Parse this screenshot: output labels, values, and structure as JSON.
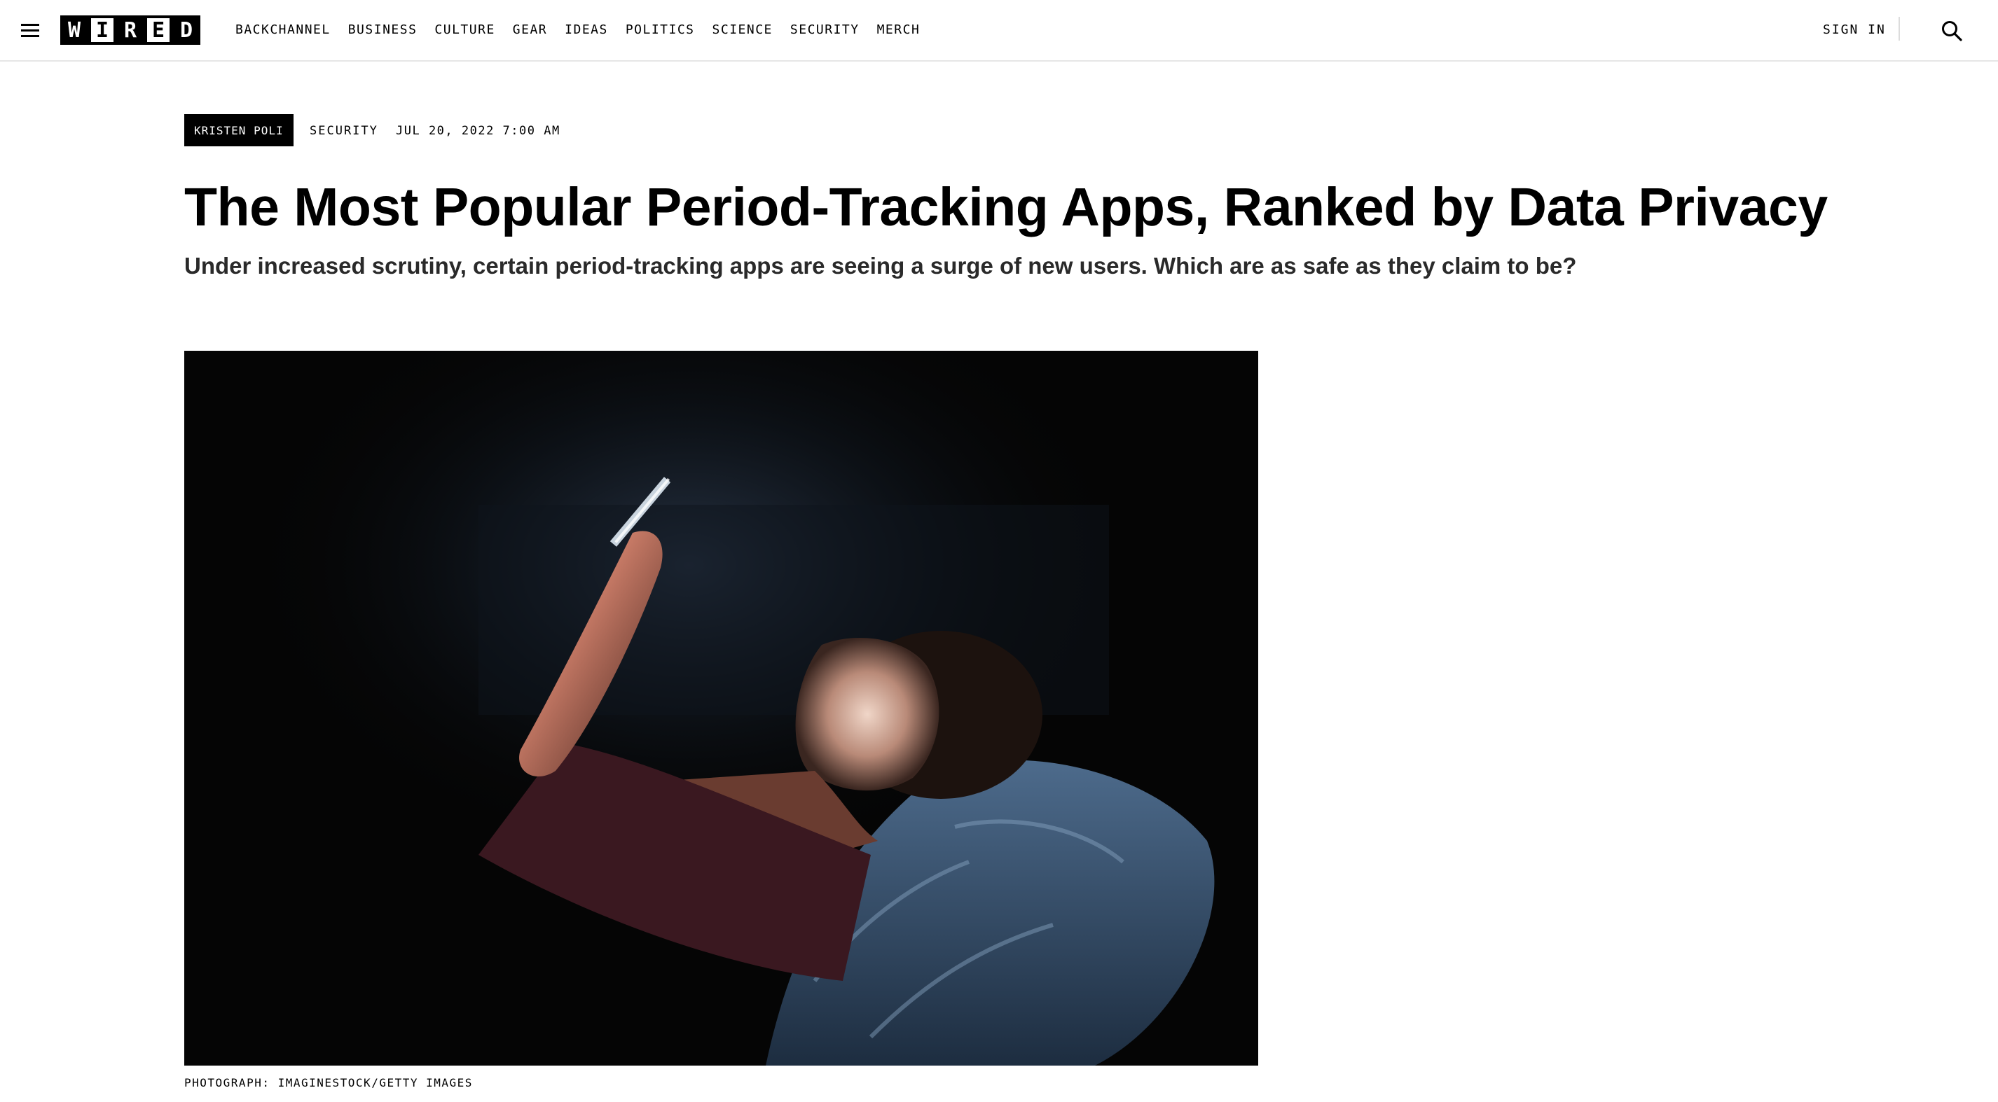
{
  "header": {
    "logo_text": "WIRED",
    "nav_items": [
      "BACKCHANNEL",
      "BUSINESS",
      "CULTURE",
      "GEAR",
      "IDEAS",
      "POLITICS",
      "SCIENCE",
      "SECURITY",
      "MERCH"
    ],
    "sign_in_label": "SIGN IN",
    "menu_icon": "hamburger-menu-icon",
    "search_icon": "search-icon"
  },
  "article": {
    "author": "KRISTEN POLI",
    "category": "SECURITY",
    "date": "JUL 20, 2022 7:00 AM",
    "title": "The Most Popular Period-Tracking Apps, Ranked by Data Privacy",
    "dek": "Under increased scrutiny, certain period-tracking apps are seeing a surge of new users. Which are as safe as they claim to be?",
    "image_caption": "PHOTOGRAPH: IMAGINESTOCK/GETTY IMAGES"
  },
  "colors": {
    "text": "#000000",
    "background": "#ffffff",
    "dek_text": "#2a2a2a",
    "divider": "#e6e6e6"
  }
}
